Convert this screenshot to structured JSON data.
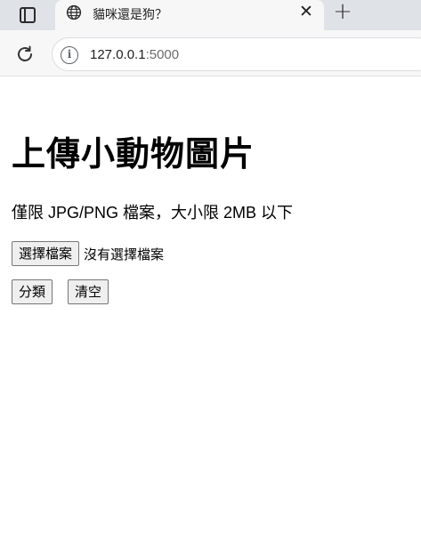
{
  "browser": {
    "tab": {
      "title": "貓咪還是狗？",
      "close_glyph": "✕"
    },
    "new_tab_glyph": "+",
    "address": {
      "host": "127.0.0.1",
      "port": ":5000"
    },
    "icons": {
      "tab_actions": "tab-actions-icon",
      "favicon": "globe-icon",
      "reload": "reload-icon",
      "info": "info-icon"
    },
    "colors": {
      "tabstrip": "#dfe3e8",
      "toolbar": "#f7f7f7"
    }
  },
  "page": {
    "title": "上傳小動物圖片",
    "note": "僅限 JPG/PNG 檔案，大小限 2MB 以下",
    "file_input": {
      "button_label": "選擇檔案",
      "status": "沒有選擇檔案"
    },
    "actions": {
      "classify_label": "分類",
      "clear_label": "清空"
    }
  }
}
